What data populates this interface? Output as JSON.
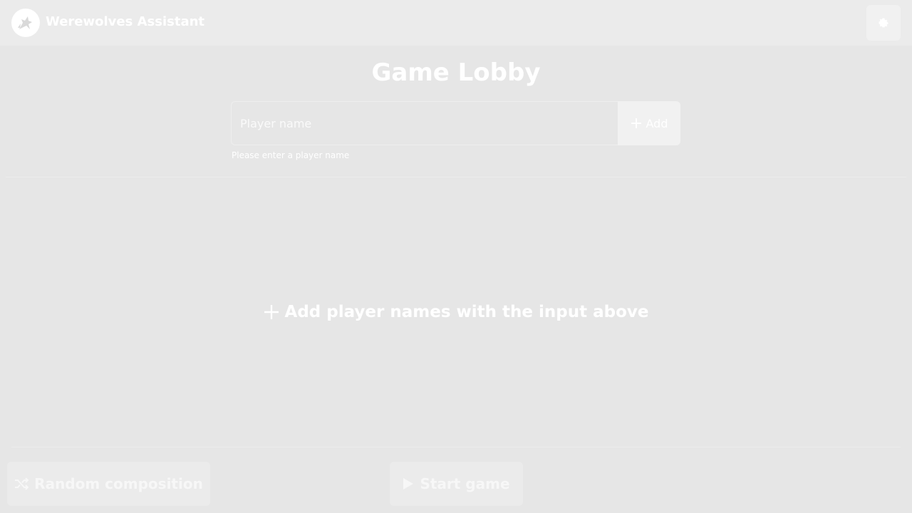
{
  "header": {
    "app_title": "Werewolves Assistant",
    "logo_icon": "wolf-logo-icon",
    "settings_icon": "gear-icon"
  },
  "lobby": {
    "title": "Game Lobby",
    "player_input": {
      "value": "",
      "placeholder": "Player name"
    },
    "add_button_label": "Add",
    "helper_text": "Please enter a player name",
    "empty_state_text": "Add player names with the input above"
  },
  "footer": {
    "random_button_label": "Random composition",
    "random_button_icon": "shuffle-icon",
    "start_button_label": "Start game",
    "start_button_icon": "play-icon"
  },
  "colors": {
    "background": "#e6e6e6",
    "header_background": "#ebebeb",
    "text": "#ffffff"
  }
}
